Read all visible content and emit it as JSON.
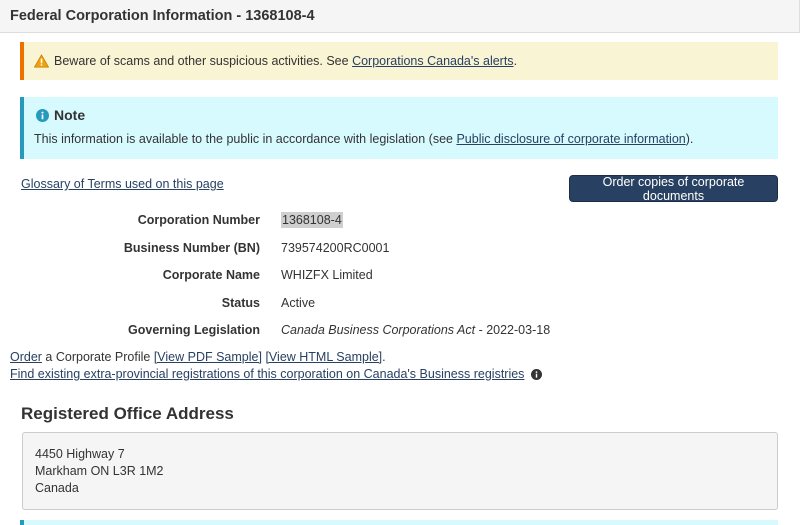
{
  "header": {
    "title": "Federal Corporation Information - 1368108-4"
  },
  "warning": {
    "text_before": "Beware of scams and other suspicious activities. See ",
    "link": "Corporations Canada's alerts",
    "text_after": "."
  },
  "note": {
    "title": "Note",
    "text_before": "This information is available to the public in accordance with legislation (see ",
    "link": "Public disclosure of corporate information",
    "text_after": ")."
  },
  "glossary_link": "Glossary of Terms used on this page",
  "order_button": "Order copies of corporate documents",
  "details": [
    {
      "label": "Corporation Number",
      "value": "1368108-4"
    },
    {
      "label": "Business Number (BN)",
      "value": "739574200RC0001"
    },
    {
      "label": "Corporate Name",
      "value": "WHIZFX Limited"
    },
    {
      "label": "Status",
      "value": "Active"
    },
    {
      "label": "Governing Legislation",
      "value_italic": "Canada Business Corporations Act",
      "value_rest": " - 2022-03-18"
    }
  ],
  "profile": {
    "order_link": "Order",
    "text_mid": " a Corporate Profile ",
    "pdf_link": "[View PDF Sample]",
    "space": " ",
    "html_link": "[View HTML Sample]",
    "end": "."
  },
  "find_link": "Find existing extra-provincial registrations of this corporation on Canada's Business registries",
  "registered_office": {
    "title": "Registered Office Address",
    "lines": [
      "4450 Highway 7",
      "Markham ON L3R 1M2",
      "Canada"
    ]
  },
  "colors": {
    "header_bg": "#f5f5f5",
    "warning_bg": "#f9f4d4",
    "warning_border": "#ee7100",
    "info_bg": "#d7faff",
    "info_border": "#269abc",
    "button_bg": "#284162",
    "link": "#284162"
  },
  "icons": {
    "warning": "warning-triangle-icon",
    "info": "info-circle-icon"
  }
}
